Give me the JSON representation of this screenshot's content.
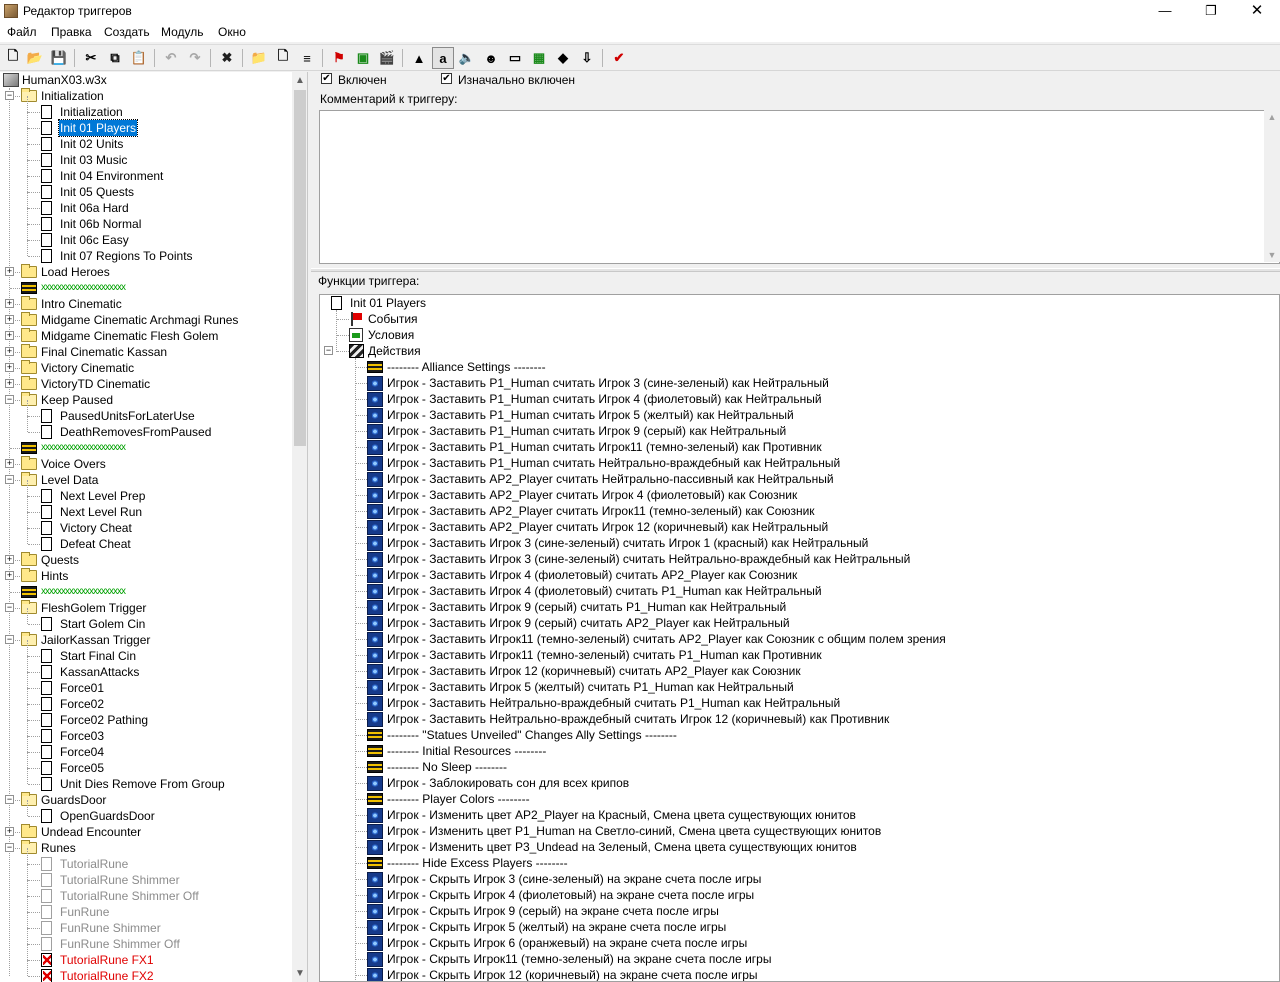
{
  "window": {
    "title": "Редактор триггеров",
    "minimize_glyph": "—",
    "maximize_glyph": "❐",
    "close_glyph": "✕"
  },
  "menu": [
    "Файл",
    "Правка",
    "Создать",
    "Модуль",
    "Окно"
  ],
  "toolbar": {
    "buttons": [
      {
        "name": "new-icon",
        "glyph": "🗋"
      },
      {
        "name": "open-icon",
        "glyph": "📂"
      },
      {
        "name": "save-icon",
        "glyph": "💾"
      },
      {
        "name": "cut-icon",
        "glyph": "✂"
      },
      {
        "name": "copy-icon",
        "glyph": "⧉"
      },
      {
        "name": "paste-icon",
        "glyph": "📋"
      },
      {
        "name": "undo-icon",
        "glyph": "↶"
      },
      {
        "name": "redo-icon",
        "glyph": "↷"
      },
      {
        "name": "test-map-icon",
        "glyph": "✖"
      },
      {
        "name": "new-category-icon",
        "glyph": "📁"
      },
      {
        "name": "new-trigger-icon",
        "glyph": "🗋"
      },
      {
        "name": "new-comment-icon",
        "glyph": "≡"
      },
      {
        "name": "new-event-icon",
        "glyph": "⚑"
      },
      {
        "name": "new-condition-icon",
        "glyph": "▣"
      },
      {
        "name": "new-action-icon",
        "glyph": "🎬"
      },
      {
        "name": "terrain-editor-icon",
        "glyph": "▲"
      },
      {
        "name": "trigger-editor-icon",
        "glyph": "a"
      },
      {
        "name": "sound-editor-icon",
        "glyph": "🔈"
      },
      {
        "name": "object-editor-icon",
        "glyph": "☻"
      },
      {
        "name": "campaign-editor-icon",
        "glyph": "▭"
      },
      {
        "name": "ai-editor-icon",
        "glyph": "▦"
      },
      {
        "name": "object-manager-icon",
        "glyph": "◆"
      },
      {
        "name": "import-manager-icon",
        "glyph": "⇩"
      },
      {
        "name": "test-map-run-icon",
        "glyph": "✔"
      }
    ]
  },
  "tree": {
    "root": "HumanX03.w3x",
    "items": [
      {
        "type": "folder",
        "label": "Initialization",
        "level": 1,
        "expanded": true
      },
      {
        "type": "trigger",
        "label": "Initialization",
        "level": 2
      },
      {
        "type": "trigger",
        "label": "Init 01 Players",
        "level": 2,
        "selected": true
      },
      {
        "type": "trigger",
        "label": "Init 02 Units",
        "level": 2
      },
      {
        "type": "trigger",
        "label": "Init 03 Music",
        "level": 2
      },
      {
        "type": "trigger",
        "label": "Init 04 Environment",
        "level": 2
      },
      {
        "type": "trigger",
        "label": "Init 05 Quests",
        "level": 2
      },
      {
        "type": "trigger",
        "label": "Init 06a Hard",
        "level": 2
      },
      {
        "type": "trigger",
        "label": "Init 06b Normal",
        "level": 2
      },
      {
        "type": "trigger",
        "label": "Init 06c Easy",
        "level": 2
      },
      {
        "type": "trigger",
        "label": "Init 07 Regions To Points",
        "level": 2
      },
      {
        "type": "folder",
        "label": "Load Heroes",
        "level": 1,
        "expanded": false
      },
      {
        "type": "comment",
        "label": "xxxxxxxxxxxxxxxxxxxxx",
        "level": 1
      },
      {
        "type": "folder",
        "label": "Intro Cinematic",
        "level": 1,
        "expanded": false
      },
      {
        "type": "folder",
        "label": "Midgame Cinematic Archmagi Runes",
        "level": 1,
        "expanded": false
      },
      {
        "type": "folder",
        "label": "Midgame Cinematic Flesh Golem",
        "level": 1,
        "expanded": false
      },
      {
        "type": "folder",
        "label": "Final Cinematic Kassan",
        "level": 1,
        "expanded": false
      },
      {
        "type": "folder",
        "label": "Victory Cinematic",
        "level": 1,
        "expanded": false
      },
      {
        "type": "folder",
        "label": "VictoryTD Cinematic",
        "level": 1,
        "expanded": false
      },
      {
        "type": "folder",
        "label": "Keep Paused",
        "level": 1,
        "expanded": true
      },
      {
        "type": "trigger",
        "label": "PausedUnitsForLaterUse",
        "level": 2
      },
      {
        "type": "trigger",
        "label": "DeathRemovesFromPaused",
        "level": 2
      },
      {
        "type": "comment",
        "label": "xxxxxxxxxxxxxxxxxxxxx",
        "level": 1
      },
      {
        "type": "folder",
        "label": "Voice Overs",
        "level": 1,
        "expanded": false
      },
      {
        "type": "folder",
        "label": "Level Data",
        "level": 1,
        "expanded": true
      },
      {
        "type": "trigger",
        "label": "Next Level Prep",
        "level": 2
      },
      {
        "type": "trigger",
        "label": "Next Level Run",
        "level": 2
      },
      {
        "type": "trigger",
        "label": "Victory Cheat",
        "level": 2
      },
      {
        "type": "trigger",
        "label": "Defeat Cheat",
        "level": 2
      },
      {
        "type": "folder",
        "label": "Quests",
        "level": 1,
        "expanded": false
      },
      {
        "type": "folder",
        "label": "Hints",
        "level": 1,
        "expanded": false
      },
      {
        "type": "comment",
        "label": "xxxxxxxxxxxxxxxxxxxxx",
        "level": 1
      },
      {
        "type": "folder",
        "label": "FleshGolem Trigger",
        "level": 1,
        "expanded": true
      },
      {
        "type": "trigger",
        "label": "Start Golem Cin",
        "level": 2
      },
      {
        "type": "folder",
        "label": "JailorKassan Trigger",
        "level": 1,
        "expanded": true
      },
      {
        "type": "trigger",
        "label": "Start Final Cin",
        "level": 2
      },
      {
        "type": "trigger",
        "label": "KassanAttacks",
        "level": 2
      },
      {
        "type": "trigger",
        "label": "Force01",
        "level": 2
      },
      {
        "type": "trigger",
        "label": "Force02",
        "level": 2
      },
      {
        "type": "trigger",
        "label": "Force02 Pathing",
        "level": 2
      },
      {
        "type": "trigger",
        "label": "Force03",
        "level": 2
      },
      {
        "type": "trigger",
        "label": "Force04",
        "level": 2
      },
      {
        "type": "trigger",
        "label": "Force05",
        "level": 2
      },
      {
        "type": "trigger",
        "label": "Unit Dies Remove From Group",
        "level": 2
      },
      {
        "type": "folder",
        "label": "GuardsDoor",
        "level": 1,
        "expanded": true
      },
      {
        "type": "trigger",
        "label": "OpenGuardsDoor",
        "level": 2
      },
      {
        "type": "folder",
        "label": "Undead Encounter",
        "level": 1,
        "expanded": false
      },
      {
        "type": "folder",
        "label": "Runes",
        "level": 1,
        "expanded": true
      },
      {
        "type": "trigger",
        "label": "TutorialRune",
        "level": 2,
        "disabled": true
      },
      {
        "type": "trigger",
        "label": "TutorialRune Shimmer",
        "level": 2,
        "disabled": true
      },
      {
        "type": "trigger",
        "label": "TutorialRune Shimmer Off",
        "level": 2,
        "disabled": true
      },
      {
        "type": "trigger",
        "label": "FunRune",
        "level": 2,
        "disabled": true
      },
      {
        "type": "trigger",
        "label": "FunRune Shimmer",
        "level": 2,
        "disabled": true
      },
      {
        "type": "trigger",
        "label": "FunRune Shimmer Off",
        "level": 2,
        "disabled": true
      },
      {
        "type": "trigger",
        "label": "TutorialRune FX1",
        "level": 2,
        "error": true
      },
      {
        "type": "trigger",
        "label": "TutorialRune FX2",
        "level": 2,
        "error": true
      }
    ]
  },
  "trigger_props": {
    "enabled_label": "Включен",
    "enabled_checked": true,
    "initially_on_label": "Изначально включен",
    "initially_on_checked": true,
    "comment_label": "Комментарий к триггеру:",
    "comment_value": "",
    "functions_label": "Функции триггера:"
  },
  "functions": {
    "trigger_name": "Init 01 Players",
    "events_label": "События",
    "conditions_label": "Условия",
    "actions_label": "Действия",
    "actions": [
      {
        "type": "comment",
        "text": "-------- Alliance Settings --------"
      },
      {
        "type": "action",
        "text": "Игрок - Заставить P1_Human считать Игрок 3 (сине-зеленый) как Нейтральный"
      },
      {
        "type": "action",
        "text": "Игрок - Заставить P1_Human считать Игрок 4 (фиолетовый) как Нейтральный"
      },
      {
        "type": "action",
        "text": "Игрок - Заставить P1_Human считать Игрок 5 (желтый) как Нейтральный"
      },
      {
        "type": "action",
        "text": "Игрок - Заставить P1_Human считать Игрок 9 (серый) как Нейтральный"
      },
      {
        "type": "action",
        "text": "Игрок - Заставить P1_Human считать Игрок11 (темно-зеленый) как Противник"
      },
      {
        "type": "action",
        "text": "Игрок - Заставить P1_Human считать Нейтрально-враждебный как Нейтральный"
      },
      {
        "type": "action",
        "text": "Игрок - Заставить AP2_Player считать Нейтрально-пассивный как Нейтральный"
      },
      {
        "type": "action",
        "text": "Игрок - Заставить AP2_Player считать Игрок 4 (фиолетовый) как Союзник"
      },
      {
        "type": "action",
        "text": "Игрок - Заставить AP2_Player считать Игрок11 (темно-зеленый) как Союзник"
      },
      {
        "type": "action",
        "text": "Игрок - Заставить AP2_Player считать Игрок 12 (коричневый) как Нейтральный"
      },
      {
        "type": "action",
        "text": "Игрок - Заставить Игрок 3 (сине-зеленый) считать Игрок 1 (красный) как Нейтральный"
      },
      {
        "type": "action",
        "text": "Игрок - Заставить Игрок 3 (сине-зеленый) считать Нейтрально-враждебный как Нейтральный"
      },
      {
        "type": "action",
        "text": "Игрок - Заставить Игрок 4 (фиолетовый) считать AP2_Player как Союзник"
      },
      {
        "type": "action",
        "text": "Игрок - Заставить Игрок 4 (фиолетовый) считать P1_Human как Нейтральный"
      },
      {
        "type": "action",
        "text": "Игрок - Заставить Игрок 9 (серый) считать P1_Human как Нейтральный"
      },
      {
        "type": "action",
        "text": "Игрок - Заставить Игрок 9 (серый) считать AP2_Player как Нейтральный"
      },
      {
        "type": "action",
        "text": "Игрок - Заставить Игрок11 (темно-зеленый) считать AP2_Player как Союзник с общим полем зрения"
      },
      {
        "type": "action",
        "text": "Игрок - Заставить Игрок11 (темно-зеленый) считать P1_Human как Противник"
      },
      {
        "type": "action",
        "text": "Игрок - Заставить Игрок 12 (коричневый) считать AP2_Player как Союзник"
      },
      {
        "type": "action",
        "text": "Игрок - Заставить Игрок 5 (желтый) считать P1_Human как Нейтральный"
      },
      {
        "type": "action",
        "text": "Игрок - Заставить Нейтрально-враждебный считать P1_Human как Нейтральный"
      },
      {
        "type": "action",
        "text": "Игрок - Заставить Нейтрально-враждебный считать Игрок 12 (коричневый) как Противник"
      },
      {
        "type": "comment",
        "text": "-------- \"Statues Unveiled\" Changes Ally Settings --------"
      },
      {
        "type": "comment",
        "text": "-------- Initial Resources --------"
      },
      {
        "type": "comment",
        "text": "-------- No Sleep --------"
      },
      {
        "type": "action",
        "text": "Игрок - Заблокировать сон для всех крипов"
      },
      {
        "type": "comment",
        "text": "-------- Player Colors --------"
      },
      {
        "type": "action",
        "text": "Игрок - Изменить цвет AP2_Player на Красный, Смена цвета существующих юнитов"
      },
      {
        "type": "action",
        "text": "Игрок - Изменить цвет P1_Human на Светло-синий, Смена цвета существующих юнитов"
      },
      {
        "type": "action",
        "text": "Игрок - Изменить цвет P3_Undead на Зеленый, Смена цвета существующих юнитов"
      },
      {
        "type": "comment",
        "text": "-------- Hide Excess Players --------"
      },
      {
        "type": "action",
        "text": "Игрок - Скрыть Игрок 3 (сине-зеленый) на экране счета после игры"
      },
      {
        "type": "action",
        "text": "Игрок - Скрыть Игрок 4 (фиолетовый) на экране счета после игры"
      },
      {
        "type": "action",
        "text": "Игрок - Скрыть Игрок 9 (серый) на экране счета после игры"
      },
      {
        "type": "action",
        "text": "Игрок - Скрыть Игрок 5 (желтый) на экране счета после игры"
      },
      {
        "type": "action",
        "text": "Игрок - Скрыть Игрок 6 (оранжевый) на экране счета после игры"
      },
      {
        "type": "action",
        "text": "Игрок - Скрыть Игрок11 (темно-зеленый) на экране счета после игры"
      },
      {
        "type": "action",
        "text": "Игрок - Скрыть Игрок 12 (коричневый) на экране счета после игры"
      }
    ]
  }
}
